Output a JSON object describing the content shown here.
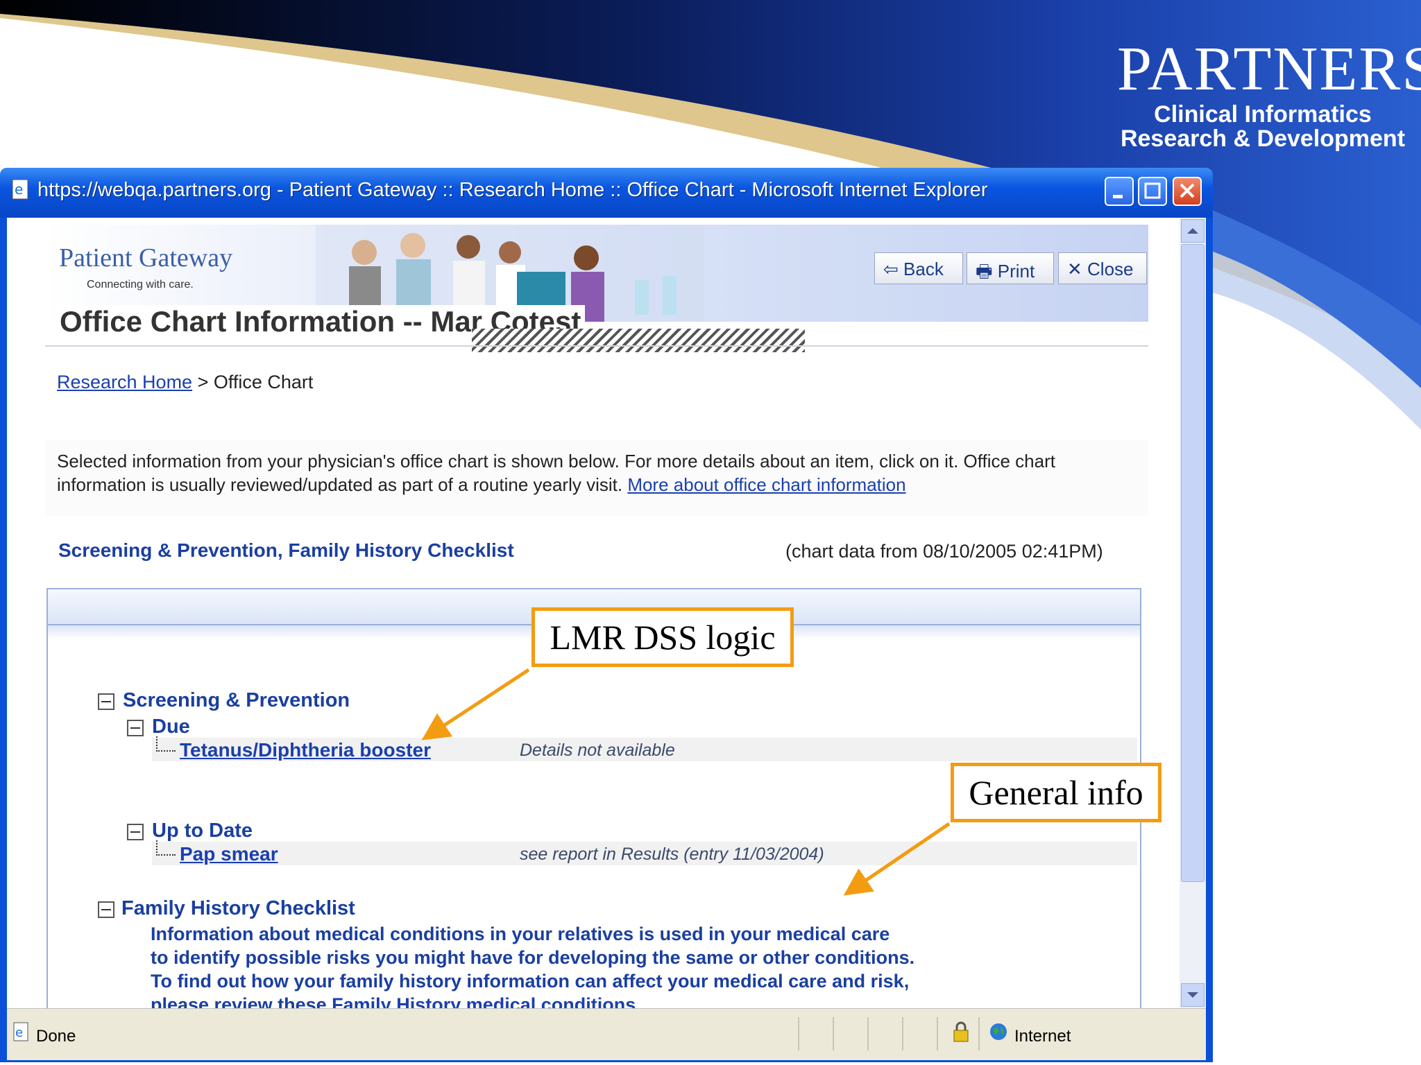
{
  "brand": {
    "name": "PARTNERS",
    "subtitle_line1": "Clinical Informatics",
    "subtitle_line2": "Research & Development"
  },
  "window": {
    "title": "https://webqa.partners.org - Patient Gateway :: Research Home :: Office Chart - Microsoft Internet Explorer",
    "status": "Done",
    "zone": "Internet"
  },
  "header": {
    "logo_title": "Patient Gateway",
    "logo_tagline": "Connecting with care.",
    "back_label": "Back",
    "print_label": "Print",
    "close_label": "Close"
  },
  "page": {
    "title": "Office Chart Information -- Mar Cotest",
    "breadcrumb_link": "Research Home",
    "breadcrumb_sep": " > ",
    "breadcrumb_current": "Office Chart",
    "intro_text": "Selected information from your physician's office chart is shown below. For more details about an item, click on it. Office chart information is usually reviewed/updated as part of a routine yearly visit. ",
    "intro_link": "More about office chart information",
    "section_heading": "Screening & Prevention, Family History Checklist",
    "chart_date": "(chart data from 08/10/2005 02:41PM)"
  },
  "tree": {
    "screening_label": "Screening & Prevention",
    "due_label": "Due",
    "due_item": "Tetanus/Diphtheria booster",
    "due_detail": "Details not available",
    "uptodate_label": "Up to Date",
    "uptodate_item": "Pap smear",
    "uptodate_detail": "see report in Results (entry 11/03/2004)",
    "family_label": "Family History Checklist",
    "family_line1": "Information about medical conditions in your relatives is used in your medical care",
    "family_line2": "to identify possible risks you might have for developing the same or other conditions.",
    "family_line3": "To find out how your family history information can affect your medical care and risk,",
    "family_line4_prefix": "please review these ",
    "family_link": "Family History medical conditions",
    "family_line4_suffix": "."
  },
  "annotations": {
    "lmr": "LMR DSS logic",
    "general": "General info"
  },
  "colors": {
    "accent": "#f39c12",
    "link": "#1a3fae",
    "titlebar": "#0a55e0"
  }
}
